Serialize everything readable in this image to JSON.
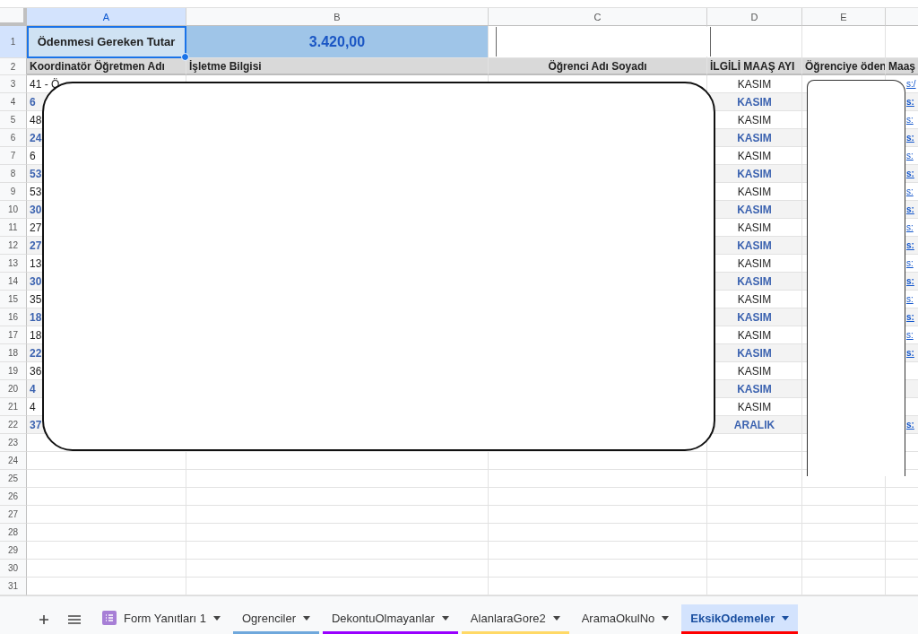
{
  "column_headers": [
    "A",
    "B",
    "C",
    "D",
    "E"
  ],
  "summary_row": {
    "number": "1",
    "label": "Ödenmesi Gereken Tutar",
    "label_selected": true,
    "amount": "3.420,00"
  },
  "header_row": {
    "number": "2",
    "cells": [
      "Koordinatör Öğretmen Adı",
      "İşletme Bilgisi",
      "Öğrenci Adı Soyadı",
      "İLGİLİ MAAŞ AYI",
      "Öğrenciye öden",
      "Maaş"
    ]
  },
  "rows": [
    {
      "number": "3",
      "coordinator": "41 - Ö",
      "month": "KASIM",
      "link": "s:/",
      "highlighted": false
    },
    {
      "number": "4",
      "coordinator": "6",
      "month": "KASIM",
      "link": "s:",
      "highlighted": true
    },
    {
      "number": "5",
      "coordinator": "48",
      "month": "KASIM",
      "link": "s:",
      "highlighted": false
    },
    {
      "number": "6",
      "coordinator": "24",
      "month": "KASIM",
      "link": "s:",
      "highlighted": true
    },
    {
      "number": "7",
      "coordinator": "6",
      "month": "KASIM",
      "link": "s:",
      "highlighted": false
    },
    {
      "number": "8",
      "coordinator": "53",
      "month": "KASIM",
      "link": "s:",
      "highlighted": true
    },
    {
      "number": "9",
      "coordinator": "53",
      "month": "KASIM",
      "link": "s:",
      "highlighted": false
    },
    {
      "number": "10",
      "coordinator": "30",
      "month": "KASIM",
      "link": "s:",
      "highlighted": true
    },
    {
      "number": "11",
      "coordinator": "27",
      "month": "KASIM",
      "link": "s:",
      "highlighted": false
    },
    {
      "number": "12",
      "coordinator": "27",
      "month": "KASIM",
      "link": "s:",
      "highlighted": true
    },
    {
      "number": "13",
      "coordinator": "13",
      "month": "KASIM",
      "link": "s:",
      "highlighted": false
    },
    {
      "number": "14",
      "coordinator": "30",
      "month": "KASIM",
      "link": "s:",
      "highlighted": true
    },
    {
      "number": "15",
      "coordinator": "35",
      "month": "KASIM",
      "link": "s:",
      "highlighted": false
    },
    {
      "number": "16",
      "coordinator": "18",
      "month": "KASIM",
      "link": "s:",
      "highlighted": true
    },
    {
      "number": "17",
      "coordinator": "18",
      "month": "KASIM",
      "link": "s:",
      "highlighted": false
    },
    {
      "number": "18",
      "coordinator": "22",
      "month": "KASIM",
      "link": "s:",
      "highlighted": true
    },
    {
      "number": "19",
      "coordinator": "36",
      "month": "KASIM",
      "highlighted": false
    },
    {
      "number": "20",
      "coordinator": "4",
      "month": "KASIM",
      "highlighted": true
    },
    {
      "number": "21",
      "coordinator": "4",
      "month": "KASIM",
      "highlighted": false
    },
    {
      "number": "22",
      "coordinator": "37",
      "month": "ARALIK",
      "link": "s:",
      "highlighted": true
    }
  ],
  "empty_rows": [
    "23",
    "24",
    "25",
    "26",
    "27",
    "28",
    "29",
    "30",
    "31"
  ],
  "sheet_tabs": [
    {
      "label": "Form Yanıtları 1",
      "kind": "form",
      "selected": false
    },
    {
      "label": "Ogrenciler",
      "kind": "sheet",
      "color": "#6fa8dc",
      "selected": false
    },
    {
      "label": "DekontuOlmayanlar",
      "kind": "sheet",
      "color": "#9900ff",
      "selected": false
    },
    {
      "label": "AlanlaraGore2",
      "kind": "sheet",
      "color": "#ffd966",
      "selected": false
    },
    {
      "label": "AramaOkulNo",
      "kind": "sheet",
      "selected": false
    },
    {
      "label": "EksikOdemeler",
      "kind": "sheet",
      "color": "#ff0000",
      "selected": true
    }
  ]
}
